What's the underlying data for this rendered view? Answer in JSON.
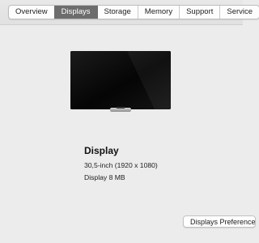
{
  "tabs": [
    {
      "label": "Overview",
      "active": false
    },
    {
      "label": "Displays",
      "active": true
    },
    {
      "label": "Storage",
      "active": false
    },
    {
      "label": "Memory",
      "active": false
    },
    {
      "label": "Support",
      "active": false
    },
    {
      "label": "Service",
      "active": false
    }
  ],
  "display": {
    "name": "Display",
    "size_resolution": "30,5-inch (1920 x 1080)",
    "graphics": "Display 8 MB"
  },
  "buttons": {
    "displays_preferences": "Displays Preferences..."
  },
  "colors": {
    "active_tab": "#6d6d6d",
    "background": "#ececec"
  },
  "icons": {
    "display": "display-icon"
  }
}
